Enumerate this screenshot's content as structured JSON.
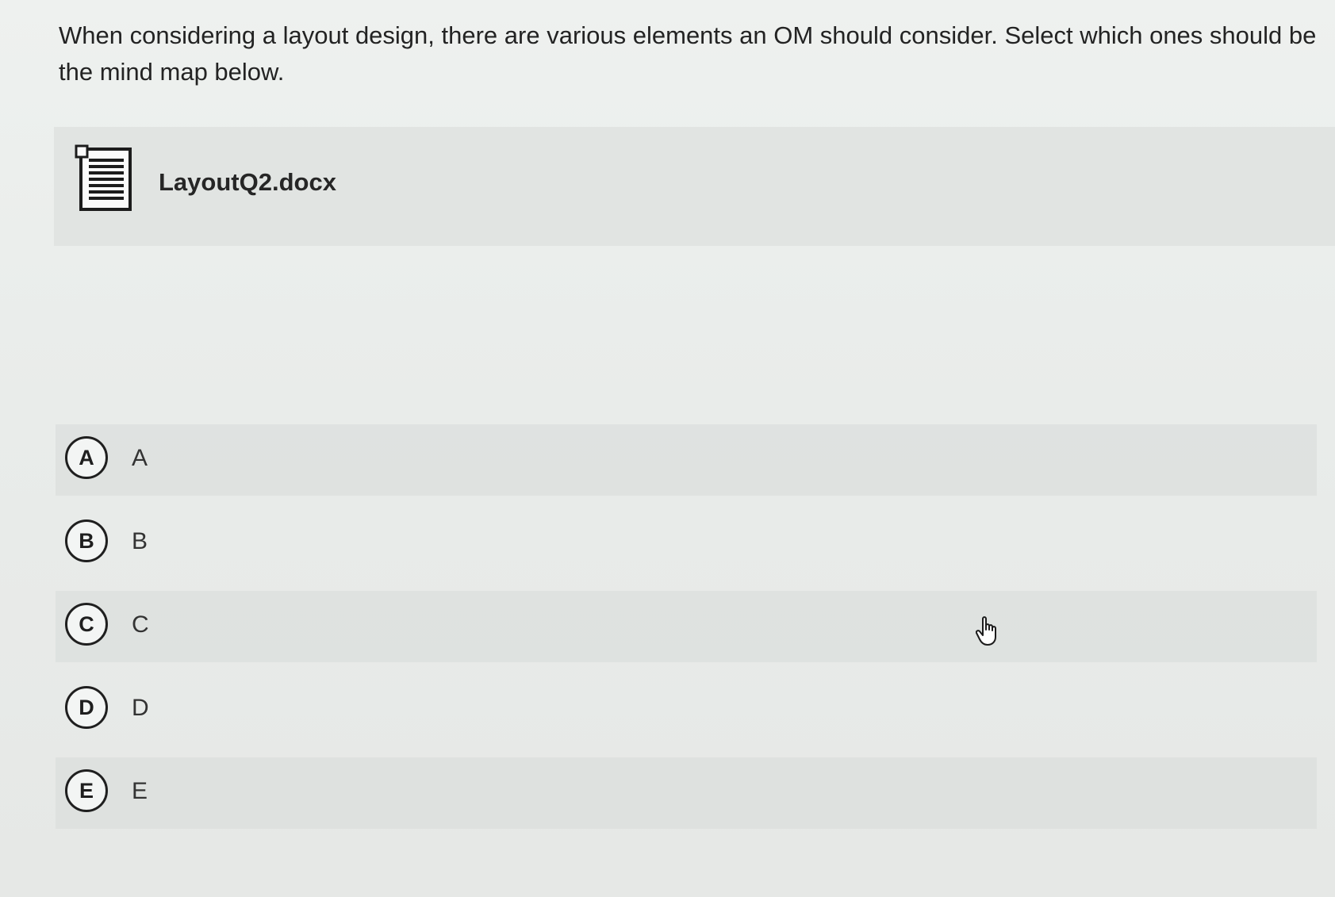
{
  "question": {
    "text": "When considering a layout design, there are various elements an OM should consider. Select which ones should be the mind map below."
  },
  "attachment": {
    "icon": "document-icon",
    "filename": "LayoutQ2.docx"
  },
  "options": [
    {
      "badge": "A",
      "label": "A"
    },
    {
      "badge": "B",
      "label": "B"
    },
    {
      "badge": "C",
      "label": "C"
    },
    {
      "badge": "D",
      "label": "D"
    },
    {
      "badge": "E",
      "label": "E"
    }
  ],
  "cursor": {
    "icon": "hand-pointer-icon"
  }
}
